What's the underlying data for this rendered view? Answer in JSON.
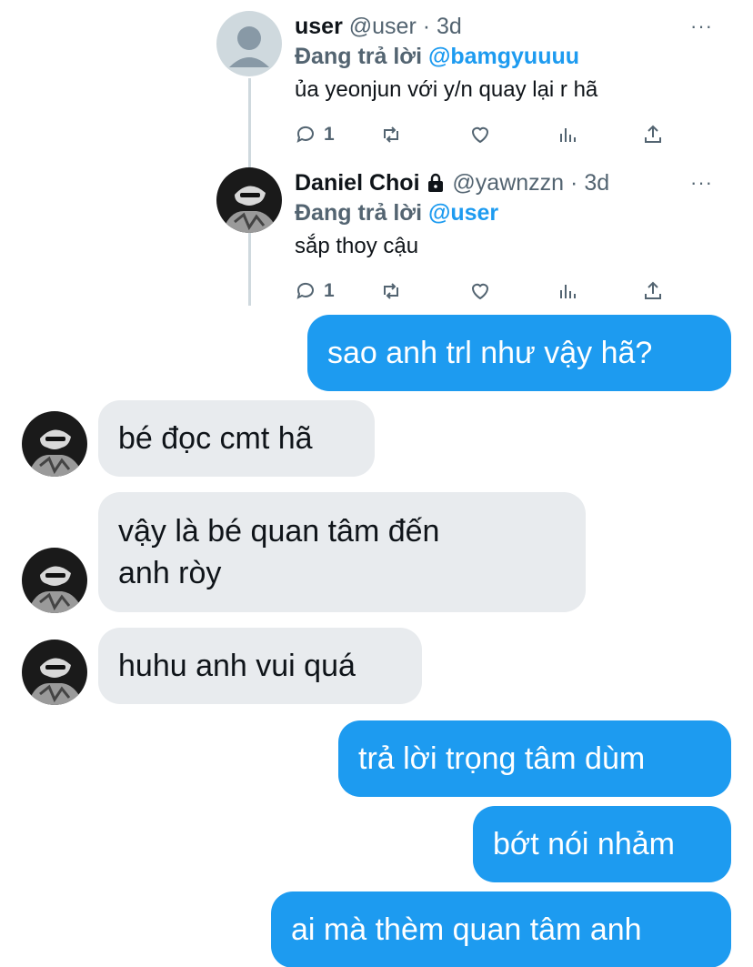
{
  "icons": {
    "more": "more-horizontal-icon",
    "reply": "reply-icon",
    "retweet": "retweet-icon",
    "like": "heart-icon",
    "views": "views-chart-icon",
    "share": "share-icon",
    "protected": "lock-icon"
  },
  "colors": {
    "accent": "#1d9bf0",
    "incoming_bubble": "#e8ebee",
    "muted_text": "#536471"
  },
  "tweets": [
    {
      "name": "user",
      "handle": "@user",
      "dot": "·",
      "time": "3d",
      "more": "···",
      "replying_prefix": "Đang trả lời ",
      "replying_to": "@bamgyuuuu",
      "text": "ủa yeonjun với y/n quay lại r hã",
      "reply_count": "1"
    },
    {
      "name": "Daniel Choi",
      "handle": "@yawnzzn",
      "dot": "·",
      "time": "3d",
      "more": "···",
      "replying_prefix": "Đang trả lời ",
      "replying_to": "@user",
      "text": "sắp thoy cậu",
      "reply_count": "1"
    }
  ],
  "messages": [
    {
      "side": "out",
      "text": "sao anh trl như vậy hã?"
    },
    {
      "side": "in",
      "text": "bé đọc cmt hã"
    },
    {
      "side": "in",
      "text_line1": "vậy là bé quan tâm đến",
      "text_line2": "anh ròy"
    },
    {
      "side": "in",
      "text": "huhu anh vui quá"
    },
    {
      "side": "out",
      "text": "trả lời trọng tâm dùm"
    },
    {
      "side": "out",
      "text": "bớt nói nhảm"
    },
    {
      "side": "out",
      "text": "ai mà thèm quan tâm anh"
    }
  ]
}
